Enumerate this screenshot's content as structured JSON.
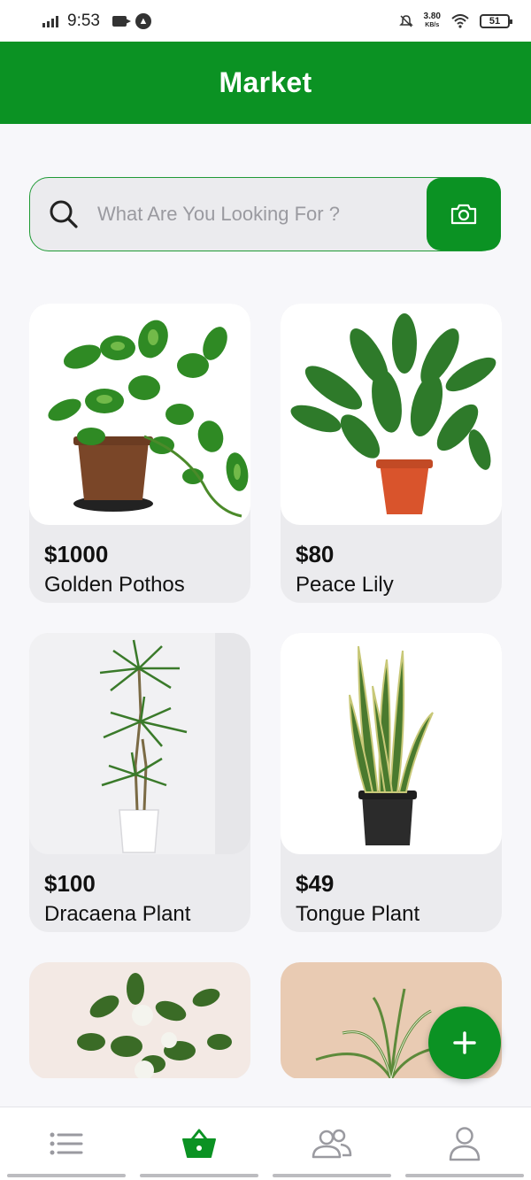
{
  "status_bar": {
    "time": "9:53",
    "net_speed_value": "3.80",
    "net_speed_unit": "KB/s",
    "battery": "51"
  },
  "header": {
    "title": "Market"
  },
  "search": {
    "placeholder": "What Are You Looking For ?"
  },
  "products": [
    {
      "price": "$1000",
      "name": "Golden Pothos"
    },
    {
      "price": "$80",
      "name": "Peace Lily"
    },
    {
      "price": "$100",
      "name": "Dracaena Plant"
    },
    {
      "price": "$49",
      "name": "Tongue Plant"
    }
  ],
  "bottom_nav": {
    "items": [
      {
        "icon": "list-icon",
        "active": false
      },
      {
        "icon": "basket-icon",
        "active": true
      },
      {
        "icon": "users-icon",
        "active": false
      },
      {
        "icon": "profile-icon",
        "active": false
      }
    ]
  },
  "colors": {
    "brand": "#0b9223",
    "card_bg": "#ebebee",
    "page_bg": "#f7f7fa"
  }
}
